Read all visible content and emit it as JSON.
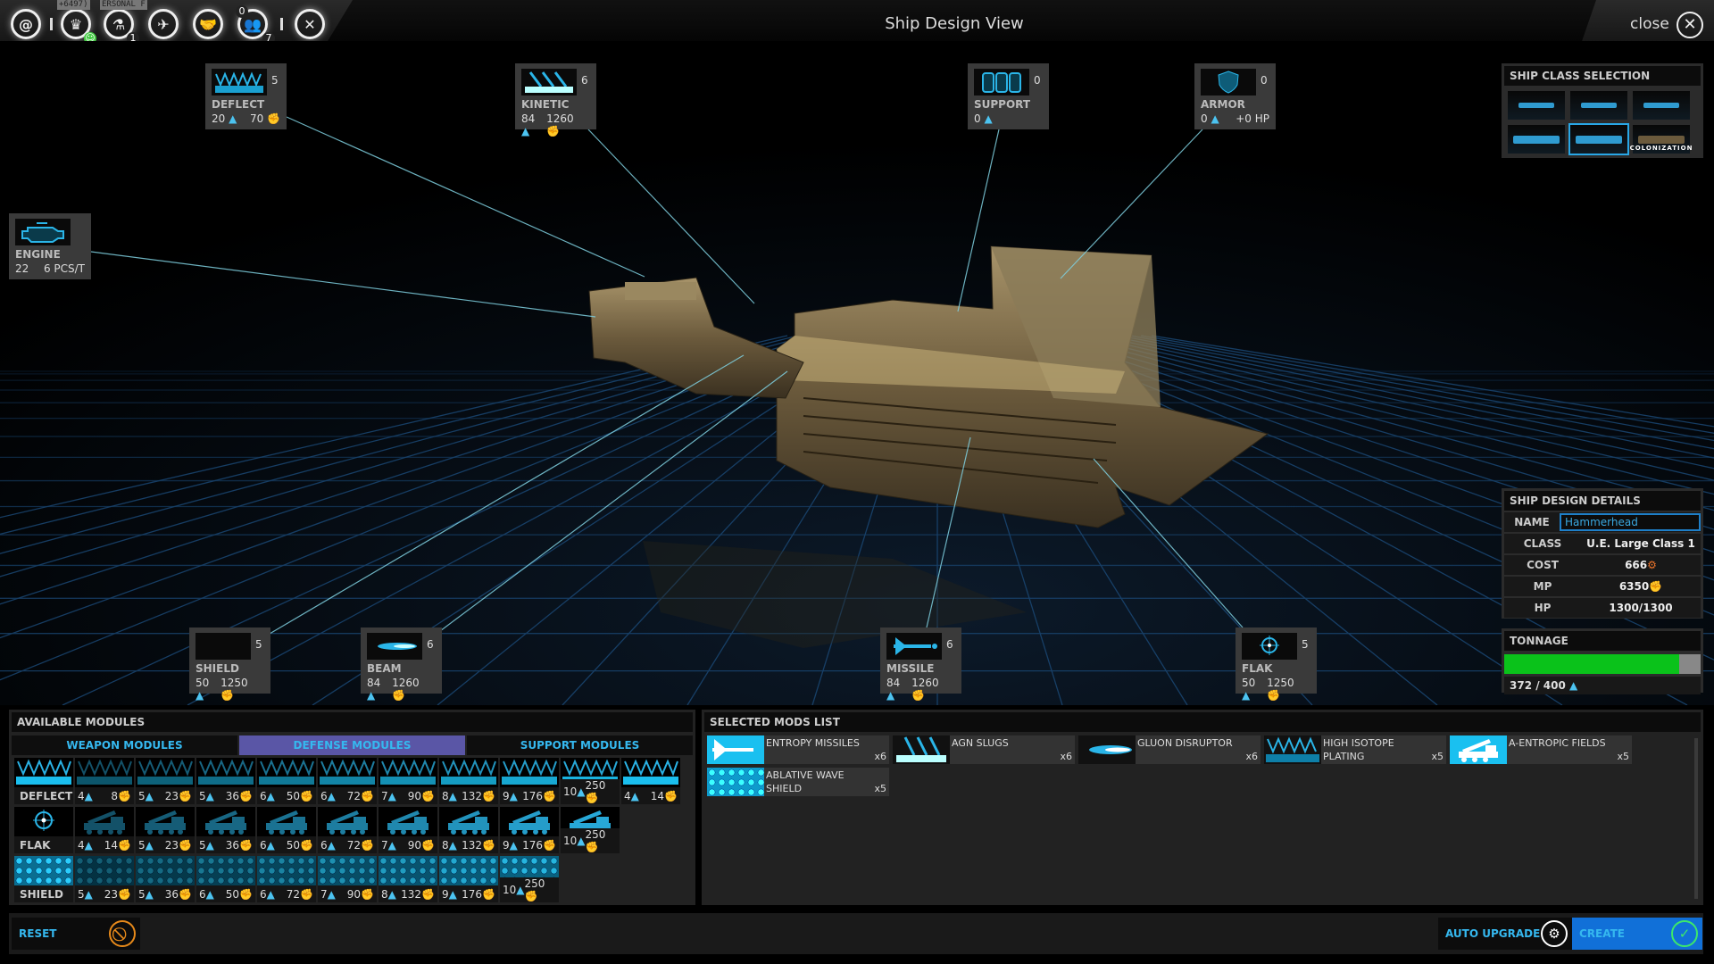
{
  "header": {
    "title": "Ship Design View",
    "close_label": "close",
    "icons": [
      {
        "name": "galaxy-icon",
        "glyph": "@"
      },
      {
        "name": "empire-laurel-icon",
        "glyph": "♛",
        "tooltip": "+6497)",
        "badge": "☺"
      },
      {
        "name": "research-microscope-icon",
        "glyph": "⚗",
        "tooltip": "ERSONAL F",
        "badge": "1"
      },
      {
        "name": "fleet-ship-icon",
        "glyph": "✈"
      },
      {
        "name": "diplomacy-handshake-icon",
        "glyph": "🤝"
      },
      {
        "name": "population-icon",
        "glyph": "👥",
        "badge": "0",
        "badge2": "7"
      },
      {
        "name": "settings-tools-icon",
        "glyph": "✕"
      }
    ]
  },
  "slots": {
    "deflect": {
      "name": "DEFLECT",
      "count": "5",
      "tonnage": "20",
      "mp": "70"
    },
    "kinetic": {
      "name": "KINETIC",
      "count": "6",
      "tonnage": "84",
      "mp": "1260"
    },
    "support": {
      "name": "SUPPORT",
      "count": "0",
      "tonnage": "0"
    },
    "armor": {
      "name": "ARMOR",
      "count": "0",
      "tonnage": "0",
      "hp": "+0 HP"
    },
    "engine": {
      "name": "ENGINE",
      "tonnage": "22",
      "speed": "6 PCS/T"
    },
    "shield": {
      "name": "SHIELD",
      "count": "5",
      "tonnage": "50",
      "mp": "1250"
    },
    "beam": {
      "name": "BEAM",
      "count": "6",
      "tonnage": "84",
      "mp": "1260"
    },
    "missile": {
      "name": "MISSILE",
      "count": "6",
      "tonnage": "84",
      "mp": "1260"
    },
    "flak": {
      "name": "FLAK",
      "count": "5",
      "tonnage": "50",
      "mp": "1250"
    }
  },
  "ship_class": {
    "title": "SHIP CLASS SELECTION",
    "classes": [
      "",
      "",
      "",
      "",
      "",
      "COLONIZATION"
    ],
    "selected_index": 4
  },
  "details": {
    "title": "SHIP DESIGN DETAILS",
    "name_label": "NAME",
    "name_value": "Hammerhead",
    "class_label": "CLASS",
    "class_value": "U.E. Large Class 1",
    "cost_label": "COST",
    "cost_value": "666",
    "mp_label": "MP",
    "mp_value": "6350",
    "hp_label": "HP",
    "hp_value": "1300/1300"
  },
  "tonnage": {
    "title": "TONNAGE",
    "text": "372 / 400",
    "used": 372,
    "max": 400
  },
  "available": {
    "title": "AVAILABLE MODULES",
    "tabs": [
      "WEAPON MODULES",
      "DEFENSE MODULES",
      "SUPPORT MODULES"
    ],
    "active_tab": 1,
    "rows": [
      {
        "type": "deflect",
        "label": "DEFLECT",
        "cells": [
          [
            "4",
            "8"
          ],
          [
            "5",
            "23"
          ],
          [
            "5",
            "36"
          ],
          [
            "6",
            "50"
          ],
          [
            "6",
            "72"
          ],
          [
            "7",
            "90"
          ],
          [
            "8",
            "132"
          ],
          [
            "9",
            "176"
          ],
          [
            "10",
            "250"
          ],
          [
            "4",
            "14"
          ]
        ]
      },
      {
        "type": "flak",
        "label": "FLAK",
        "cells": [
          [
            "4",
            "14"
          ],
          [
            "5",
            "23"
          ],
          [
            "5",
            "36"
          ],
          [
            "6",
            "50"
          ],
          [
            "6",
            "72"
          ],
          [
            "7",
            "90"
          ],
          [
            "8",
            "132"
          ],
          [
            "9",
            "176"
          ],
          [
            "10",
            "250"
          ]
        ]
      },
      {
        "type": "shield",
        "label": "SHIELD",
        "cells": [
          [
            "5",
            "23"
          ],
          [
            "5",
            "36"
          ],
          [
            "6",
            "50"
          ],
          [
            "6",
            "72"
          ],
          [
            "7",
            "90"
          ],
          [
            "8",
            "132"
          ],
          [
            "9",
            "176"
          ],
          [
            "10",
            "250"
          ]
        ]
      }
    ]
  },
  "selected": {
    "title": "SELECTED MODS LIST",
    "items": [
      {
        "name": "ENTROPY MISSILES",
        "qty": "x6",
        "icon": "missile-icon"
      },
      {
        "name": "AGN SLUGS",
        "qty": "x6",
        "icon": "kinetic-icon"
      },
      {
        "name": "GLUON DISRUPTOR",
        "qty": "x6",
        "icon": "beam-icon"
      },
      {
        "name": "HIGH ISOTOPE PLATING",
        "qty": "x5",
        "icon": "deflect-icon"
      },
      {
        "name": "A-ENTROPIC FIELDS",
        "qty": "x5",
        "icon": "flak-icon"
      },
      {
        "name": "ABLATIVE WAVE SHIELD",
        "qty": "x5",
        "icon": "shield-icon"
      }
    ]
  },
  "footer": {
    "reset": "RESET",
    "auto_upgrade": "AUTO UPGRADE",
    "create": "CREATE"
  },
  "colors": {
    "accent": "#35b8ef",
    "create": "#1170d8",
    "tonnage_fill": "#0ac21a",
    "reset": "#e88a1a"
  }
}
